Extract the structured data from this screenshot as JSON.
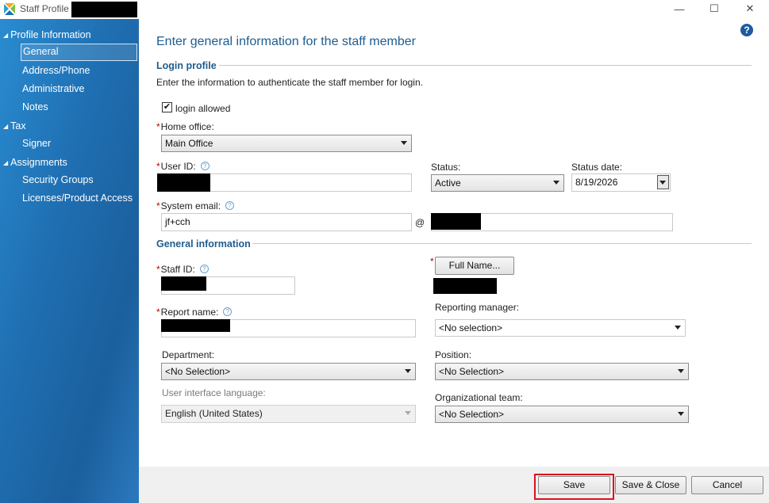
{
  "window": {
    "title": "Staff Profile -",
    "controls": {
      "minimize": "—",
      "maximize": "☐",
      "close": "✕"
    }
  },
  "sidebar": {
    "groups": [
      {
        "label": "Profile Information",
        "items": [
          "General",
          "Address/Phone",
          "Administrative",
          "Notes"
        ]
      },
      {
        "label": "Tax",
        "items": [
          "Signer"
        ]
      },
      {
        "label": "Assignments",
        "items": [
          "Security Groups",
          "Licenses/Product Access"
        ]
      }
    ],
    "selected": "General"
  },
  "main": {
    "heading": "Enter general information for the staff member",
    "help": "?",
    "login_profile": {
      "title": "Login profile",
      "description": "Enter the information to authenticate the staff member for login.",
      "login_allowed": {
        "label": "login allowed",
        "checked": true,
        "mark": "✔"
      },
      "home_office": {
        "label": "Home office:",
        "value": "Main Office"
      },
      "user_id": {
        "label": "User ID:",
        "value": ""
      },
      "status": {
        "label": "Status:",
        "value": "Active"
      },
      "status_date": {
        "label": "Status date:",
        "value": "8/19/2026"
      },
      "system_email": {
        "label": "System email:",
        "value": "jf+cch",
        "at": "@"
      }
    },
    "general_information": {
      "title": "General information",
      "staff_id": {
        "label": "Staff ID:"
      },
      "full_name_button": "Full Name...",
      "report_name": {
        "label": "Report name:"
      },
      "reporting_manager": {
        "label": "Reporting manager:",
        "value": "<No selection>"
      },
      "department": {
        "label": "Department:",
        "value": "<No Selection>"
      },
      "position": {
        "label": "Position:",
        "value": "<No Selection>"
      },
      "ui_language": {
        "label": "User interface language:",
        "value": "English (United States)"
      },
      "org_team": {
        "label": "Organizational team:",
        "value": "<No Selection>"
      }
    },
    "required_marker": "*",
    "info_marker": "?"
  },
  "footer": {
    "save": "Save",
    "save_close": "Save & Close",
    "cancel": "Cancel"
  },
  "colors": {
    "accent": "#1f5c8f",
    "sidebar": "#1f6fb2",
    "required": "#c00000",
    "highlight": "#d9141c"
  }
}
